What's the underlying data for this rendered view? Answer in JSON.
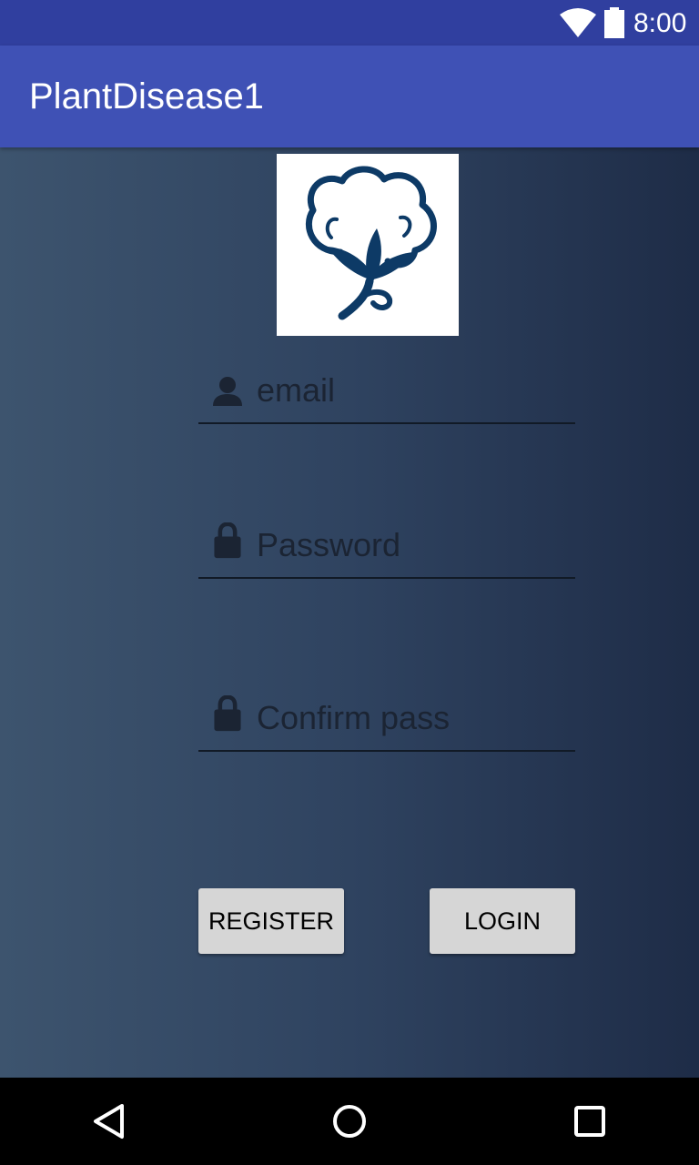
{
  "status_bar": {
    "time": "8:00",
    "icons": [
      "wifi-icon",
      "battery-icon"
    ]
  },
  "app_bar": {
    "title": "PlantDisease1"
  },
  "logo": {
    "icon": "cotton-plant-logo",
    "color": "#0d3a66"
  },
  "form": {
    "email": {
      "placeholder": "email",
      "value": "",
      "icon": "person-icon"
    },
    "password": {
      "placeholder": "Password",
      "value": "",
      "icon": "lock-icon"
    },
    "confirm": {
      "placeholder": "Confirm pass",
      "value": "",
      "icon": "lock-icon"
    }
  },
  "buttons": {
    "register": "REGISTER",
    "login": "LOGIN"
  },
  "nav_bar": {
    "icons": [
      "back-icon",
      "home-icon",
      "recents-icon"
    ]
  },
  "colors": {
    "status_bar": "#303f9f",
    "app_bar": "#3f51b5",
    "background_start": "#3d546e",
    "background_end": "#1e2c47",
    "button": "#d6d6d6"
  }
}
